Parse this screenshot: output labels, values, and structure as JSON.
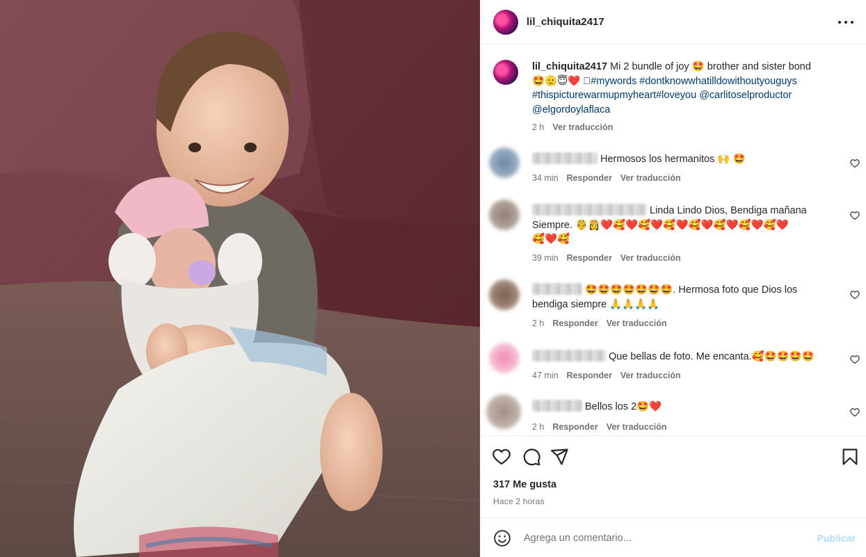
{
  "post": {
    "username": "lil_chiquita2417",
    "more_icon": "more-horizontal-icon"
  },
  "caption": {
    "username": "lil_chiquita2417",
    "text_1": "Mi 2 bundle of joy 🤩 brother and sister bond",
    "text_2": "🤩🫡😇❤️ 🏻",
    "hashtags": [
      "#mywords",
      "#dontknowwhatilldowithoutyouguys",
      "#thispicturewarmupmyheart",
      "#loveyou"
    ],
    "mentions": [
      "@carlitoselproductor",
      "@elgordoylaflaca"
    ],
    "time": "2 h",
    "translate": "Ver traducción"
  },
  "comments": [
    {
      "text": "Hermosos los hermanitos 🙌 🤩",
      "time": "34 min",
      "reply": "Responder",
      "translate": "Ver traducción",
      "avatar_color": "#8fa7c2"
    },
    {
      "text_1": "Linda Lindo Dios, Bendiga mañana",
      "text_2": "Siempre. 🤴👸❤️🥰❤️🥰❤️🥰❤️🥰❤️🥰❤️🥰❤️🥰❤️",
      "text_3": "🥰❤️🥰",
      "time": "39 min",
      "reply": "Responder",
      "translate": "Ver traducción",
      "avatar_color": "#a89a92"
    },
    {
      "text_1": "🤩🤩🤩🤩🤩🤩🤩. Hermosa foto que Dios los",
      "text_2": "bendiga siempre 🙏🙏🙏🙏",
      "time": "2 h",
      "reply": "Responder",
      "translate": "Ver traducción",
      "avatar_color": "#9c8070"
    },
    {
      "text": "Que bellas de foto. Me encanta.🥰🤩🤩🤩🤩",
      "time": "47 min",
      "reply": "Responder",
      "translate": "Ver traducción",
      "avatar_color": "#f3b6cf"
    },
    {
      "text": "Bellos los 2🤩❤️",
      "time": "2 h",
      "reply": "Responder",
      "translate": "Ver traducción",
      "avatar_color": "#b3a49c"
    }
  ],
  "actions": {
    "like_icon": "heart-icon",
    "comment_icon": "comment-icon",
    "share_icon": "send-icon",
    "save_icon": "bookmark-icon",
    "likes": "317 Me gusta",
    "posted": "Hace 2 horas"
  },
  "add_comment": {
    "placeholder": "Agrega un comentario...",
    "publish": "Publicar",
    "emoji_icon": "smiley-icon"
  },
  "colors": {
    "link": "#00376b",
    "muted": "#737373",
    "text": "#262626",
    "publish_disabled": "#b3dbff",
    "border": "#efefef"
  }
}
